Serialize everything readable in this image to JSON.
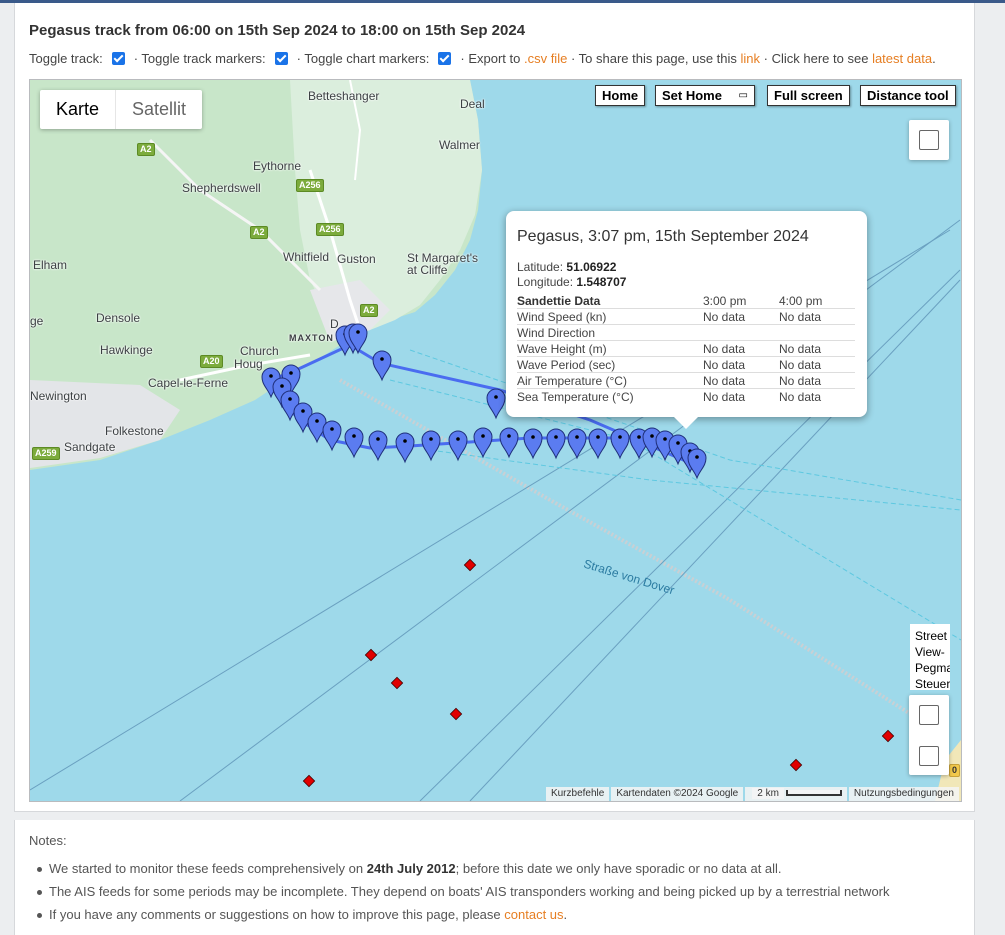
{
  "page": {
    "title": "Pegasus track from 06:00 on 15th Sep 2024 to 18:00 on 15th Sep 2024"
  },
  "controls": {
    "toggle_track_label": "Toggle track:",
    "toggle_track_markers_label": "· Toggle track markers:",
    "toggle_chart_markers_label": "· Toggle chart markers:",
    "export_prefix": "· Export to",
    "export_link": ".csv file",
    "share_prefix": "· To share this page, use this",
    "share_link": "link",
    "latest_prefix": "· Click here to see",
    "latest_link": "latest data",
    "latest_suffix": ".",
    "toggle_track_checked": true,
    "toggle_track_markers_checked": true,
    "toggle_chart_markers_checked": true
  },
  "map": {
    "type_control": {
      "map": "Karte",
      "satellite": "Satellit"
    },
    "buttons": {
      "home": "Home",
      "set_home": "Set Home",
      "full_screen": "Full screen",
      "distance_tool": "Distance tool"
    },
    "set_home_symbol": "▭",
    "pegman_text": "Street\nView-\nPegman\nSteuerung",
    "places": {
      "betteshanger": "Betteshanger",
      "deal": "Deal",
      "walmer": "Walmer",
      "eythorne": "Eythorne",
      "shepherdswell": "Shepherdswell",
      "whitfield": "Whitfield",
      "guston": "Guston",
      "st_margarets_1": "St Margaret's",
      "st_margarets_2": "at Cliffe",
      "elham": "Elham",
      "ge": "ge",
      "densole": "Densole",
      "hawkinge": "Hawkinge",
      "maxton": "MAXTON",
      "dover": "D",
      "church_hougham_1": "Church",
      "church_hougham_2": "Houg",
      "capel": "Capel-le-Ferne",
      "newington": "Newington",
      "folkestone": "Folkestone",
      "sandgate": "Sandgate",
      "strait": "Straße von Dover"
    },
    "roads": {
      "a2_a": "A2",
      "a256_a": "A256",
      "a2_b": "A2",
      "a256_b": "A256",
      "a2_c": "A2",
      "a20": "A20",
      "a259": "A259",
      "a20_edge": "0"
    },
    "attribution": {
      "shortcuts": "Kurzbefehle",
      "data": "Kartendaten ©2024 Google",
      "scale": "2 km",
      "terms": "Nutzungsbedingungen"
    },
    "colors": {
      "sea": "#9ed9ea",
      "land": "#c8e6c9",
      "track": "#4a6cf0",
      "marker": "#5b7cf0",
      "chart_marker": "#e00000"
    }
  },
  "popup": {
    "title": "Pegasus, 3:07 pm, 15th September 2024",
    "latitude_label": "Latitude:",
    "latitude_value": "51.06922",
    "longitude_label": "Longitude:",
    "longitude_value": "1.548707",
    "header": {
      "station": "Sandettie Data",
      "t1": "3:00 pm",
      "t2": "4:00 pm"
    },
    "rows": [
      {
        "label": "Wind Speed (kn)",
        "v1": "No data",
        "v2": "No data"
      },
      {
        "label": "Wind Direction",
        "v1": "",
        "v2": ""
      },
      {
        "label": "Wave Height (m)",
        "v1": "No data",
        "v2": "No data"
      },
      {
        "label": "Wave Period (sec)",
        "v1": "No data",
        "v2": "No data"
      },
      {
        "label": "Air Temperature (°C)",
        "v1": "No data",
        "v2": "No data"
      },
      {
        "label": "Sea Temperature (°C)",
        "v1": "No data",
        "v2": "No data"
      }
    ]
  },
  "notes": {
    "title": "Notes:",
    "n1_prefix": "We started to monitor these feeds comprehensively on",
    "n1_bold": "24th July 2012",
    "n1_suffix": "; before this date we only have sporadic or no data at all.",
    "n2": "The AIS feeds for some periods may be incomplete. They depend on boats' AIS transponders working and being picked up by a terrestrial network",
    "n3_prefix": "If you have any comments or suggestions on how to improve this page, please",
    "n3_link": "contact us",
    "n3_suffix": "."
  }
}
